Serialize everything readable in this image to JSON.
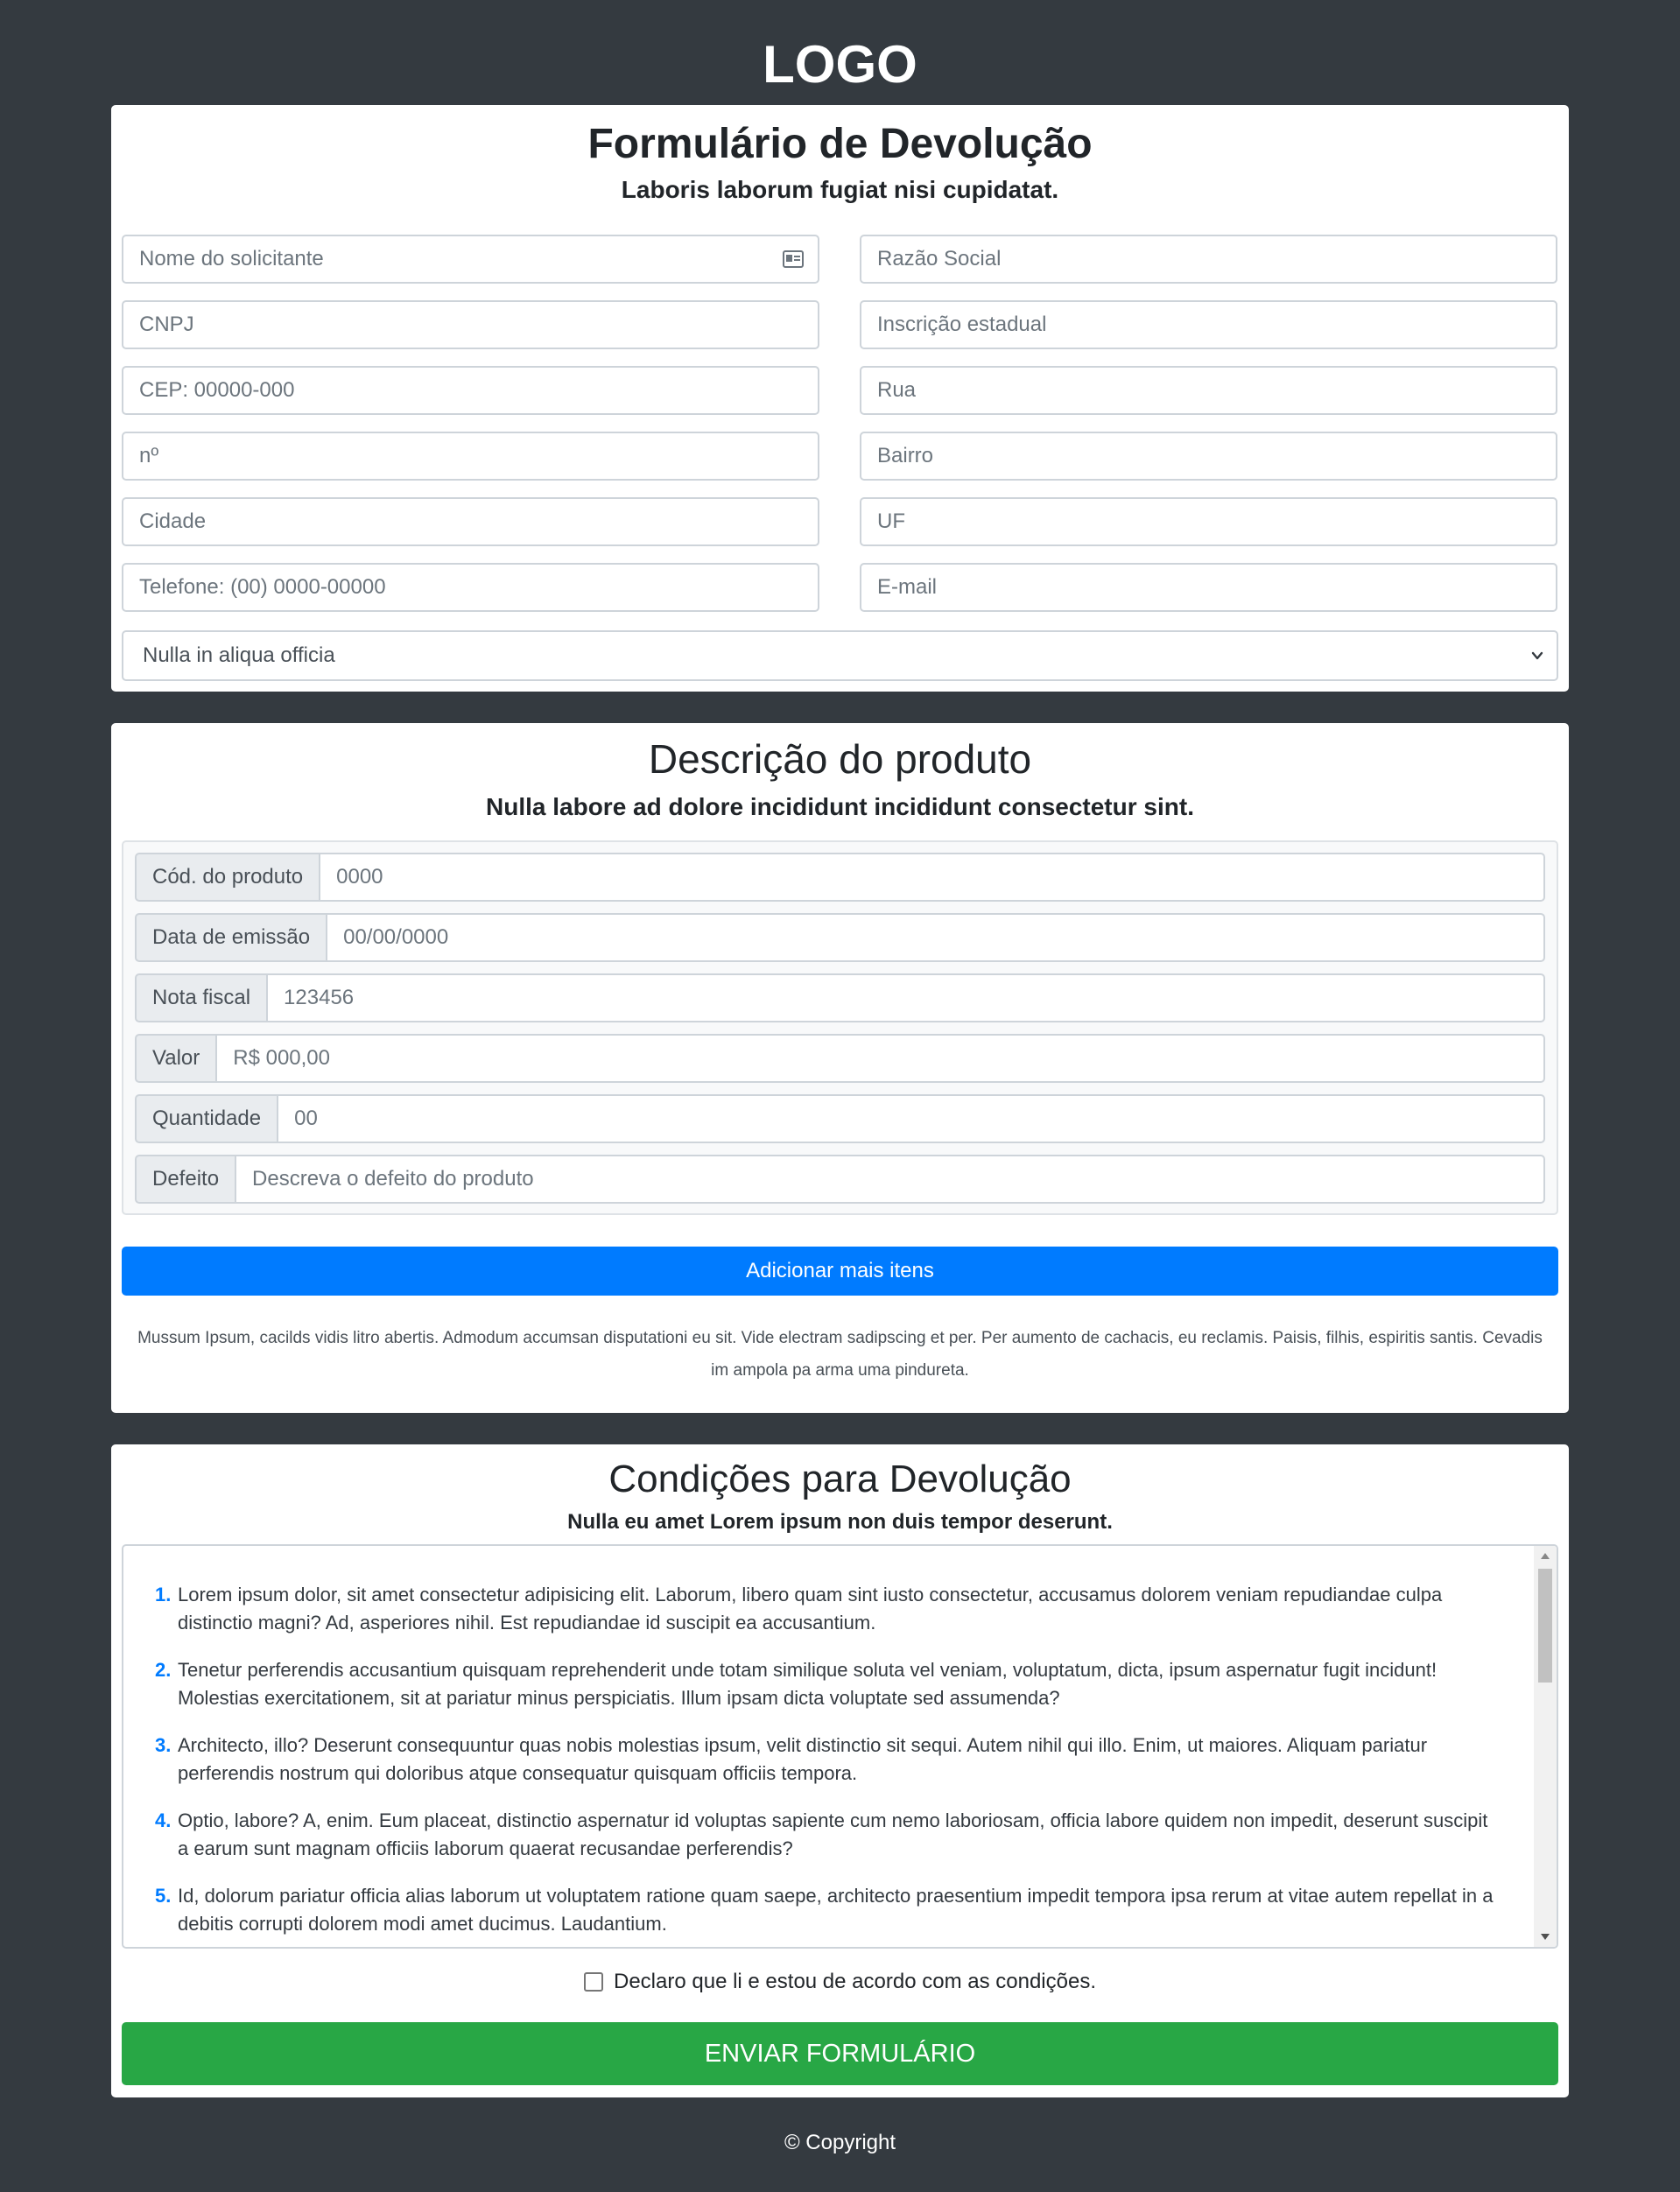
{
  "header": {
    "logo_text": "LOGO"
  },
  "form_card": {
    "title": "Formulário de Devolução",
    "subtitle": "Laboris laborum fugiat nisi cupidatat.",
    "fields": [
      {
        "placeholder": "Nome do solicitante",
        "icon": "id-card-icon"
      },
      {
        "placeholder": "Razão Social"
      },
      {
        "placeholder": "CNPJ"
      },
      {
        "placeholder": "Inscrição estadual"
      },
      {
        "placeholder": "CEP: 00000-000"
      },
      {
        "placeholder": "Rua"
      },
      {
        "placeholder": "nº"
      },
      {
        "placeholder": "Bairro"
      },
      {
        "placeholder": "Cidade"
      },
      {
        "placeholder": "UF"
      },
      {
        "placeholder": "Telefone: (00) 0000-00000"
      },
      {
        "placeholder": "E-mail"
      }
    ],
    "select": {
      "selected": "Nulla in aliqua officia",
      "icon": "chevron-down-icon"
    }
  },
  "product_card": {
    "title": "Descrição do produto",
    "subtitle": "Nulla labore ad dolore incididunt incididunt consectetur sint.",
    "rows": [
      {
        "label": "Cód. do produto",
        "placeholder": "0000"
      },
      {
        "label": "Data de emissão",
        "placeholder": "00/00/0000"
      },
      {
        "label": "Nota fiscal",
        "placeholder": "123456"
      },
      {
        "label": "Valor",
        "placeholder": "R$ 000,00"
      },
      {
        "label": "Quantidade",
        "placeholder": "00"
      },
      {
        "label": "Defeito",
        "placeholder": "Descreva o defeito do produto"
      }
    ],
    "add_button": "Adicionar mais itens",
    "note": "Mussum Ipsum, cacilds vidis litro abertis. Admodum accumsan disputationi eu sit. Vide electram sadipscing et per. Per aumento de cachacis, eu reclamis. Paisis, filhis, espiritis santis. Cevadis im ampola pa arma uma pindureta."
  },
  "conditions_card": {
    "title": "Condições para Devolução",
    "subtitle": "Nulla eu amet Lorem ipsum non duis tempor deserunt.",
    "items": [
      {
        "num": "1.",
        "text": "Lorem ipsum dolor, sit amet consectetur adipisicing elit. Laborum, libero quam sint iusto consectetur, accusamus dolorem veniam repudiandae culpa distinctio magni? Ad, asperiores nihil. Est repudiandae id suscipit ea accusantium."
      },
      {
        "num": "2.",
        "text": "Tenetur perferendis accusantium quisquam reprehenderit unde totam similique soluta vel veniam, voluptatum, dicta, ipsum aspernatur fugit incidunt! Molestias exercitationem, sit at pariatur minus perspiciatis. Illum ipsam dicta voluptate sed assumenda?"
      },
      {
        "num": "3.",
        "text": "Architecto, illo? Deserunt consequuntur quas nobis molestias ipsum, velit distinctio sit sequi. Autem nihil qui illo. Enim, ut maiores. Aliquam pariatur perferendis nostrum qui doloribus atque consequatur quisquam officiis tempora."
      },
      {
        "num": "4.",
        "text": "Optio, labore? A, enim. Eum placeat, distinctio aspernatur id voluptas sapiente cum nemo laboriosam, officia labore quidem non impedit, deserunt suscipit a earum sunt magnam officiis laborum quaerat recusandae perferendis?"
      },
      {
        "num": "5.",
        "text": "Id, dolorum pariatur officia alias laborum ut voluptatem ratione quam saepe, architecto praesentium impedit tempora ipsa rerum at vitae autem repellat in a debitis corrupti dolorem modi amet ducimus. Laudantium."
      }
    ],
    "agree_label": "Declaro que li e estou de acordo com as condições.",
    "submit_button": "ENVIAR FORMULÁRIO"
  },
  "footer": {
    "copyright": "© Copyright"
  },
  "colors": {
    "background": "#343a40",
    "primary": "#007bff",
    "success": "#28a745"
  }
}
